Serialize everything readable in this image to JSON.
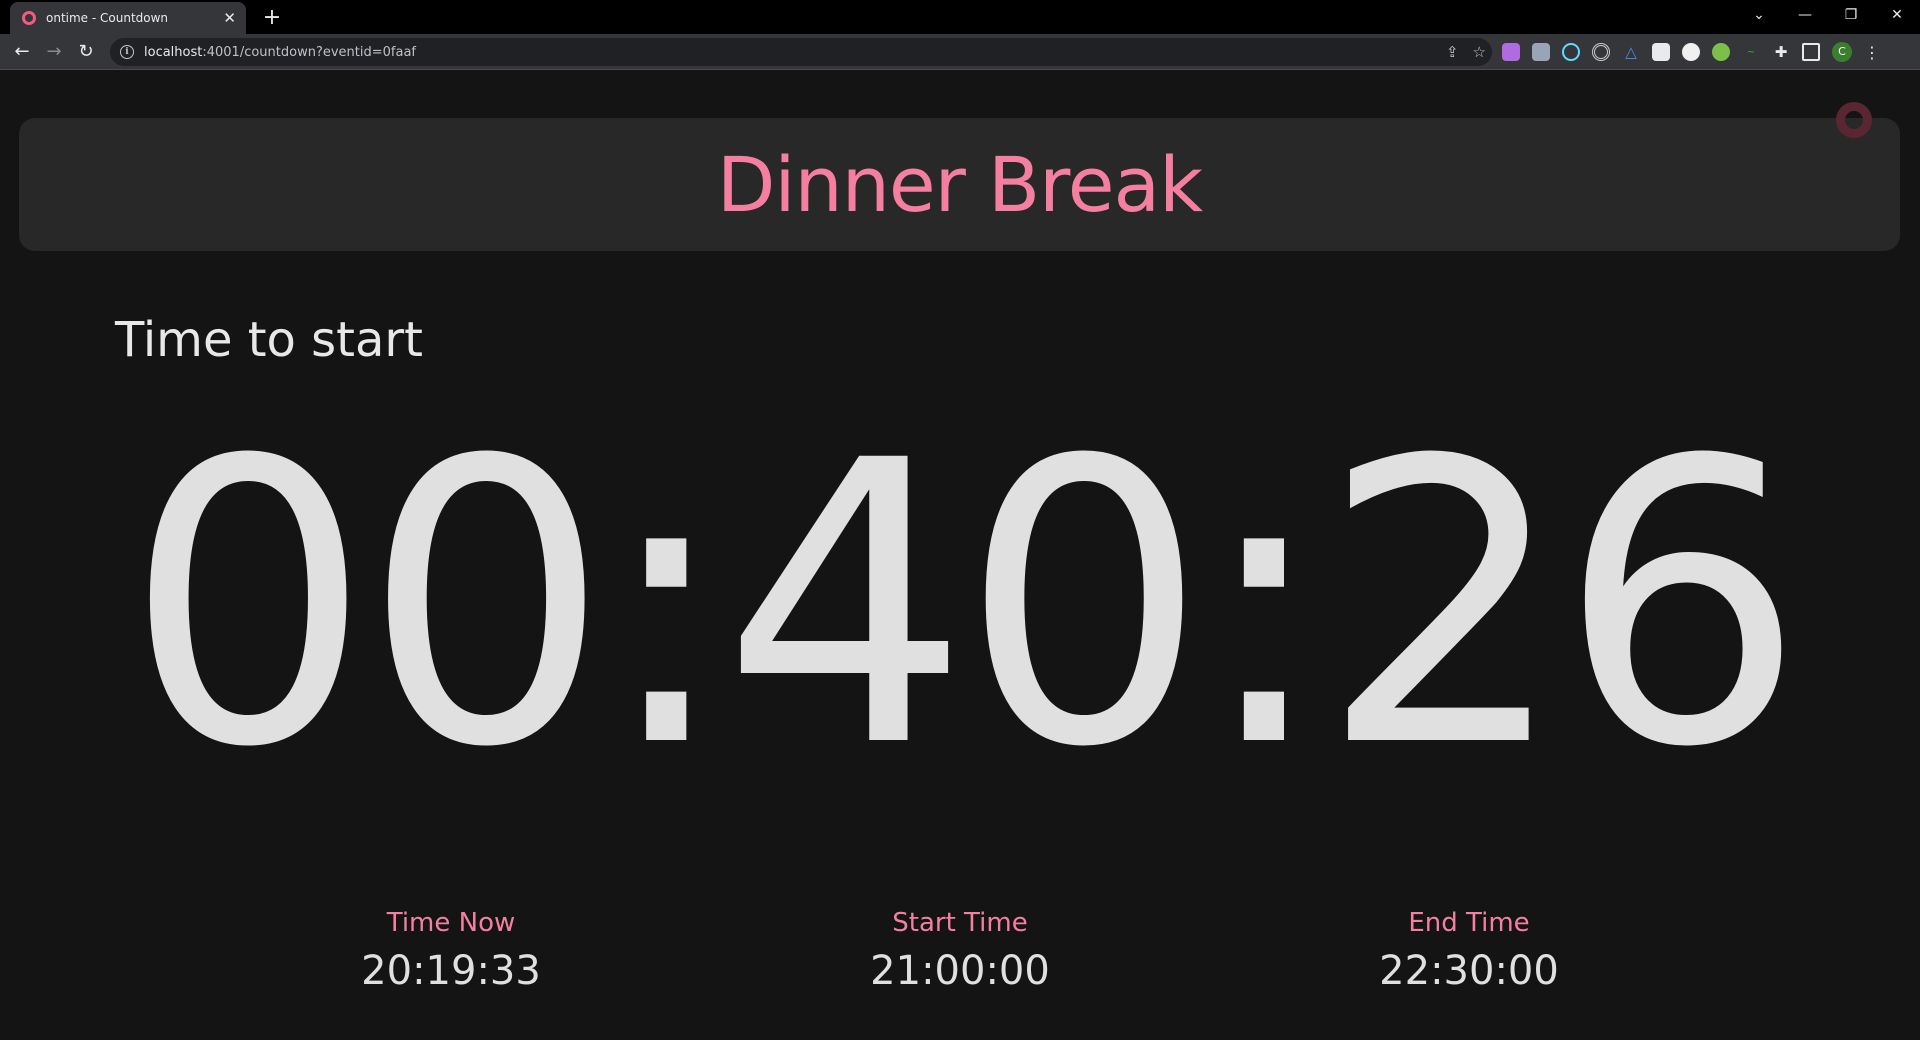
{
  "browser": {
    "tab_title": "ontime - Countdown",
    "url_host": "localhost",
    "url_rest": ":4001/countdown?eventid=0faaf",
    "profile_initial": "C"
  },
  "event": {
    "title": "Dinner Break"
  },
  "timer": {
    "label": "Time to start",
    "value": "00:40:26"
  },
  "info": [
    {
      "label": "Time Now",
      "value": "20:19:33"
    },
    {
      "label": "Start Time",
      "value": "21:00:00"
    },
    {
      "label": "End Time",
      "value": "22:30:00"
    }
  ],
  "colors": {
    "accent": "#f57fa1",
    "background": "#141414",
    "card": "#282828",
    "text": "#e0e0e0"
  }
}
